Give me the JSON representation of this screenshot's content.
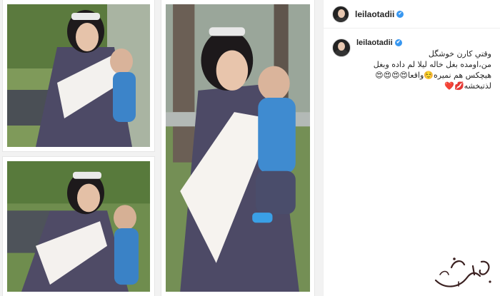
{
  "header": {
    "username": "leilaotadii",
    "verified_mark": "✔"
  },
  "caption": {
    "username": "leilaotadii",
    "lines": [
      "وقتي كارن خوشگل",
      "من،اومده بغل خاله ليلا لم داده وبغل",
      "هيچكس هم نميره☺️واقعا😍😍😍😍",
      "لذتبخشه💋❤️"
    ]
  },
  "colors": {
    "accent": "#3897f0",
    "text": "#262626",
    "border": "#efefef"
  },
  "icons": [
    "verified-badge-icon",
    "avatar",
    "watermark-logo"
  ]
}
